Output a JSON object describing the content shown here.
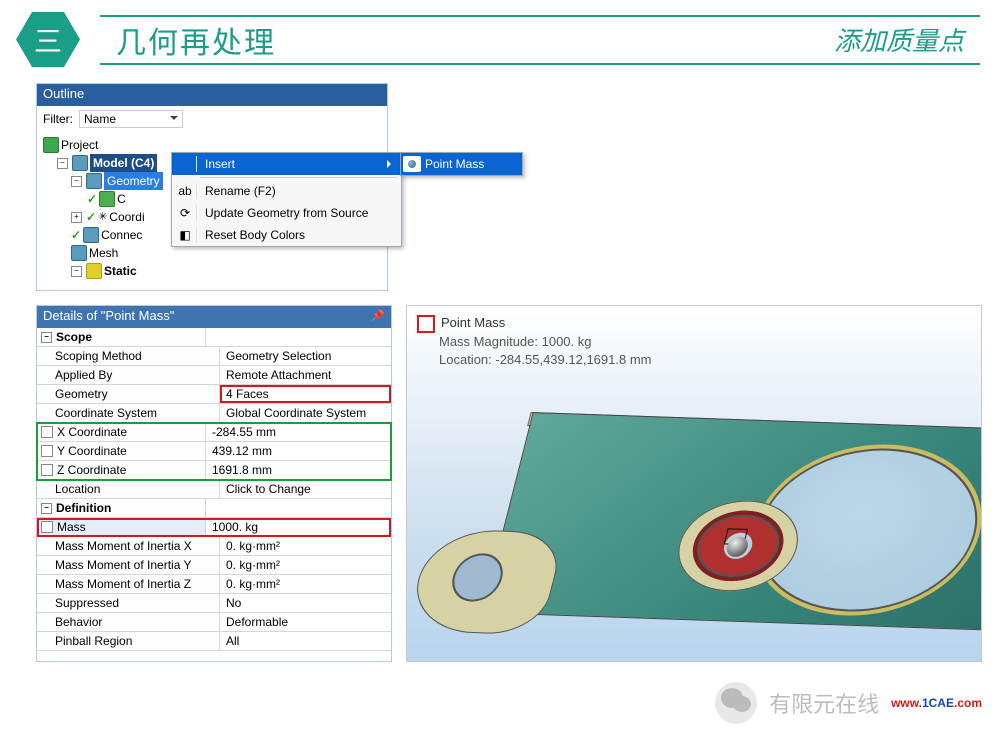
{
  "slide": {
    "marker": "三",
    "title": "几何再处理",
    "subtitle": "添加质量点"
  },
  "outline": {
    "panel_title": "Outline",
    "filter_label": "Filter:",
    "filter_value": "Name",
    "tree": {
      "project": "Project",
      "model": "Model (C4)",
      "geometry": "Geometry",
      "geom_child": "C",
      "coord": "Coordi",
      "connec": "Connec",
      "mesh": "Mesh",
      "static": "Static"
    }
  },
  "context_menu": {
    "insert": "Insert",
    "rename": "Rename (F2)",
    "update": "Update Geometry from Source",
    "reset": "Reset Body Colors",
    "submenu_pointmass": "Point Mass"
  },
  "details": {
    "title": "Details of \"Point Mass\"",
    "groups": {
      "scope": "Scope",
      "definition": "Definition"
    },
    "rows": {
      "scoping_method": {
        "label": "Scoping Method",
        "value": "Geometry Selection"
      },
      "applied_by": {
        "label": "Applied By",
        "value": "Remote Attachment"
      },
      "geometry": {
        "label": "Geometry",
        "value": "4 Faces"
      },
      "csys": {
        "label": "Coordinate System",
        "value": "Global Coordinate System"
      },
      "x": {
        "label": "X Coordinate",
        "value": "-284.55 mm"
      },
      "y": {
        "label": "Y Coordinate",
        "value": "439.12 mm"
      },
      "z": {
        "label": "Z Coordinate",
        "value": "1691.8 mm"
      },
      "location": {
        "label": "Location",
        "value": "Click to Change"
      },
      "mass": {
        "label": "Mass",
        "value": "1000. kg"
      },
      "moi_x": {
        "label": "Mass Moment of Inertia X",
        "value": "0. kg·mm²"
      },
      "moi_y": {
        "label": "Mass Moment of Inertia Y",
        "value": "0. kg·mm²"
      },
      "moi_z": {
        "label": "Mass Moment of Inertia Z",
        "value": "0. kg·mm²"
      },
      "suppressed": {
        "label": "Suppressed",
        "value": "No"
      },
      "behavior": {
        "label": "Behavior",
        "value": "Deformable"
      },
      "pinball": {
        "label": "Pinball Region",
        "value": "All"
      }
    }
  },
  "viewport": {
    "title": "Point Mass",
    "mag": "Mass Magnitude: 1000. kg",
    "loc": "Location: -284.55,439.12,1691.8 mm"
  },
  "watermark": {
    "cn_full": "有限元在线",
    "url_pre": "www.",
    "url_mid": "1CAE",
    "url_suf": ".com"
  }
}
